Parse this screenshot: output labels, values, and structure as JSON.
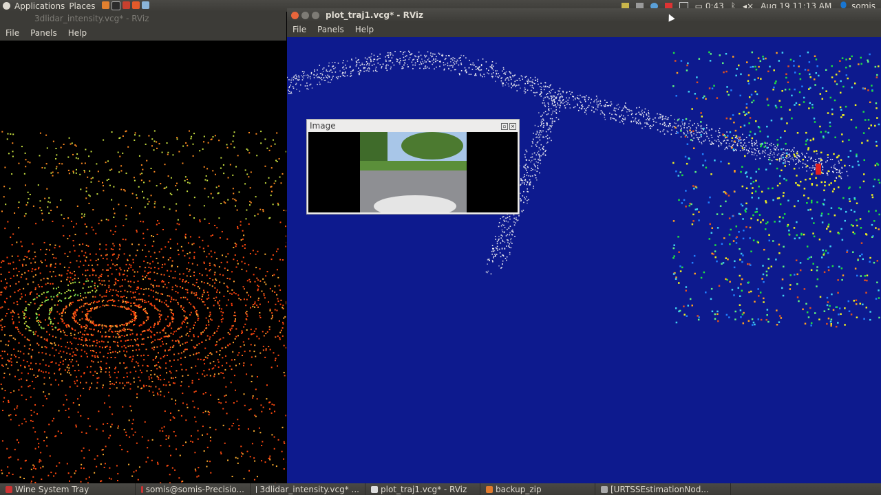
{
  "top_panel": {
    "applications": "Applications",
    "places": "Places",
    "battery": "0:43",
    "datetime": "Aug 19 11:13 AM",
    "user": "somis"
  },
  "left_window": {
    "title": "3dlidar_intensity.vcg* - RViz",
    "menu": [
      "File",
      "Panels",
      "Help"
    ]
  },
  "right_window": {
    "title": "plot_traj1.vcg* - RViz",
    "menu": [
      "File",
      "Panels",
      "Help"
    ],
    "background_color": "#0d1a8e"
  },
  "image_panel": {
    "title": "Image"
  },
  "taskbar": {
    "items": [
      "Wine System Tray",
      "somis@somis-Precisio...",
      "3dlidar_intensity.vcg* ...",
      "plot_traj1.vcg* - RViz",
      "backup_zip",
      "[URTSSEstimationNod..."
    ]
  }
}
